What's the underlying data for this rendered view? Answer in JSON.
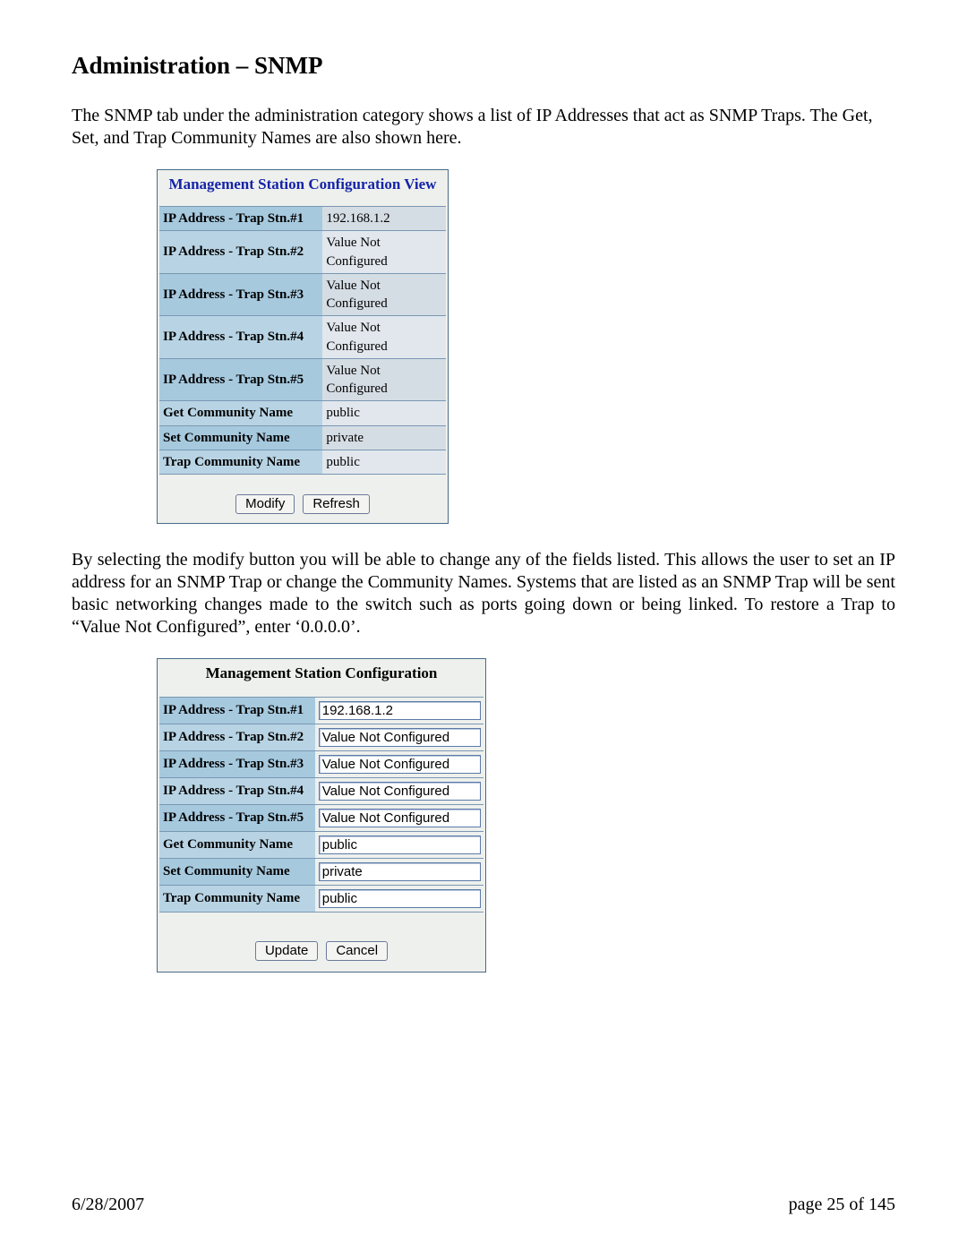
{
  "heading": "Administration – SNMP",
  "intro": "The SNMP tab under the administration category shows a list of IP Addresses that act as SNMP Traps.  The Get, Set, and Trap Community Names are also shown here.",
  "view_panel": {
    "title": "Management Station Configuration View",
    "rows": [
      {
        "label": "IP Address - Trap Stn.#1",
        "value": "192.168.1.2"
      },
      {
        "label": "IP Address - Trap Stn.#2",
        "value": "Value Not Configured"
      },
      {
        "label": "IP Address - Trap Stn.#3",
        "value": "Value Not Configured"
      },
      {
        "label": "IP Address - Trap Stn.#4",
        "value": "Value Not Configured"
      },
      {
        "label": "IP Address - Trap Stn.#5",
        "value": "Value Not Configured"
      },
      {
        "label": "Get Community Name",
        "value": "public"
      },
      {
        "label": "Set Community Name",
        "value": "private"
      },
      {
        "label": "Trap Community Name",
        "value": "public"
      }
    ],
    "modify_btn": "Modify",
    "refresh_btn": "Refresh"
  },
  "mid_text": "By selecting the modify button you will be able to change any of the fields listed.  This allows the user to set an IP address for an SNMP Trap or change the Community Names.  Systems that are listed as an SNMP Trap will be sent basic networking changes made to the switch such as ports going down or being linked.  To restore a Trap to “Value Not Configured”, enter ‘0.0.0.0’.",
  "edit_panel": {
    "title": "Management Station Configuration",
    "rows": [
      {
        "label": "IP Address - Trap Stn.#1",
        "value": "192.168.1.2"
      },
      {
        "label": "IP Address - Trap Stn.#2",
        "value": "Value Not Configured"
      },
      {
        "label": "IP Address - Trap Stn.#3",
        "value": "Value Not Configured"
      },
      {
        "label": "IP Address - Trap Stn.#4",
        "value": "Value Not Configured"
      },
      {
        "label": "IP Address - Trap Stn.#5",
        "value": "Value Not Configured"
      },
      {
        "label": "Get Community Name",
        "value": "public"
      },
      {
        "label": "Set Community Name",
        "value": "private"
      },
      {
        "label": "Trap Community Name",
        "value": "public"
      }
    ],
    "update_btn": "Update",
    "cancel_btn": "Cancel"
  },
  "footer_date": "6/28/2007",
  "footer_page": "page 25 of 145"
}
